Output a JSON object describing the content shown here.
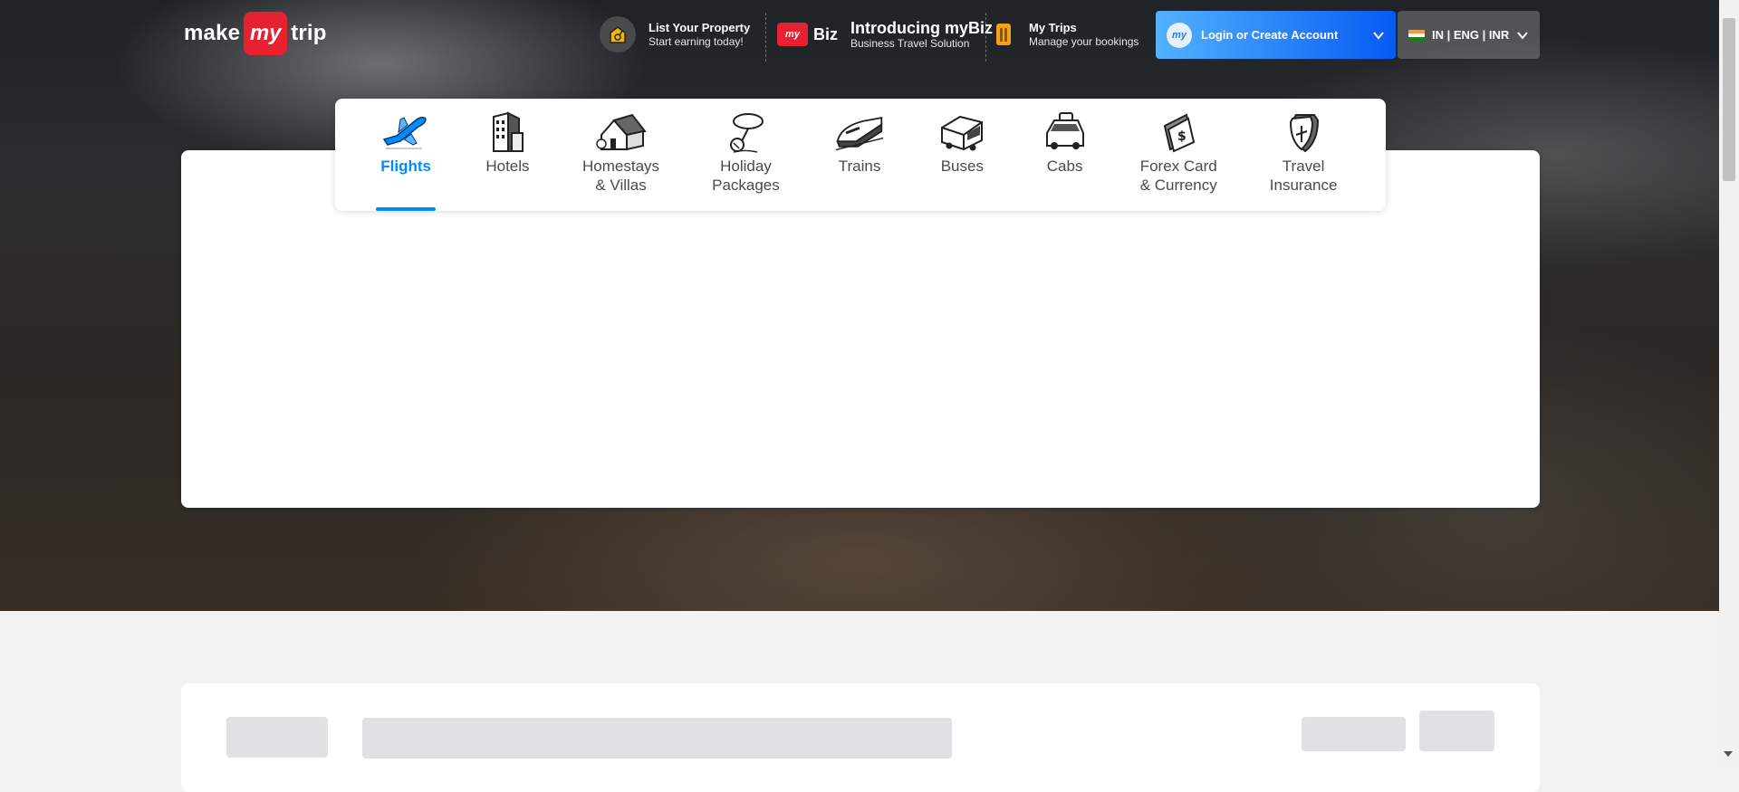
{
  "brand": {
    "logo_left": "make",
    "logo_badge": "my",
    "logo_right": "trip"
  },
  "header": {
    "list_property": {
      "title": "List Your Property",
      "subtitle": "Start earning today!"
    },
    "mybiz": {
      "badge": "my",
      "word": "Biz",
      "title": "Introducing myBiz",
      "subtitle": "Business Travel Solution"
    },
    "my_trips": {
      "title": "My Trips",
      "subtitle": "Manage your bookings"
    },
    "login": {
      "avatar": "my",
      "label": "Login or Create Account"
    },
    "locale": {
      "label": "IN | ENG | INR"
    }
  },
  "nav": {
    "items": [
      {
        "label": "Flights",
        "icon": "flight-icon",
        "active": true
      },
      {
        "label": "Hotels",
        "icon": "hotel-icon"
      },
      {
        "label": "Homestays\n& Villas",
        "icon": "homestay-icon"
      },
      {
        "label": "Holiday\nPackages",
        "icon": "holiday-icon"
      },
      {
        "label": "Trains",
        "icon": "train-icon"
      },
      {
        "label": "Buses",
        "icon": "bus-icon"
      },
      {
        "label": "Cabs",
        "icon": "cab-icon"
      },
      {
        "label": "Forex Card\n& Currency",
        "icon": "forex-icon"
      },
      {
        "label": "Travel\nInsurance",
        "icon": "insurance-icon"
      }
    ]
  },
  "colors": {
    "accent": "#008cff",
    "brand_red": "#e7212f",
    "login_gradient_start": "#53b2fe",
    "login_gradient_end": "#065af3",
    "skeleton": "#e1e1e3"
  }
}
